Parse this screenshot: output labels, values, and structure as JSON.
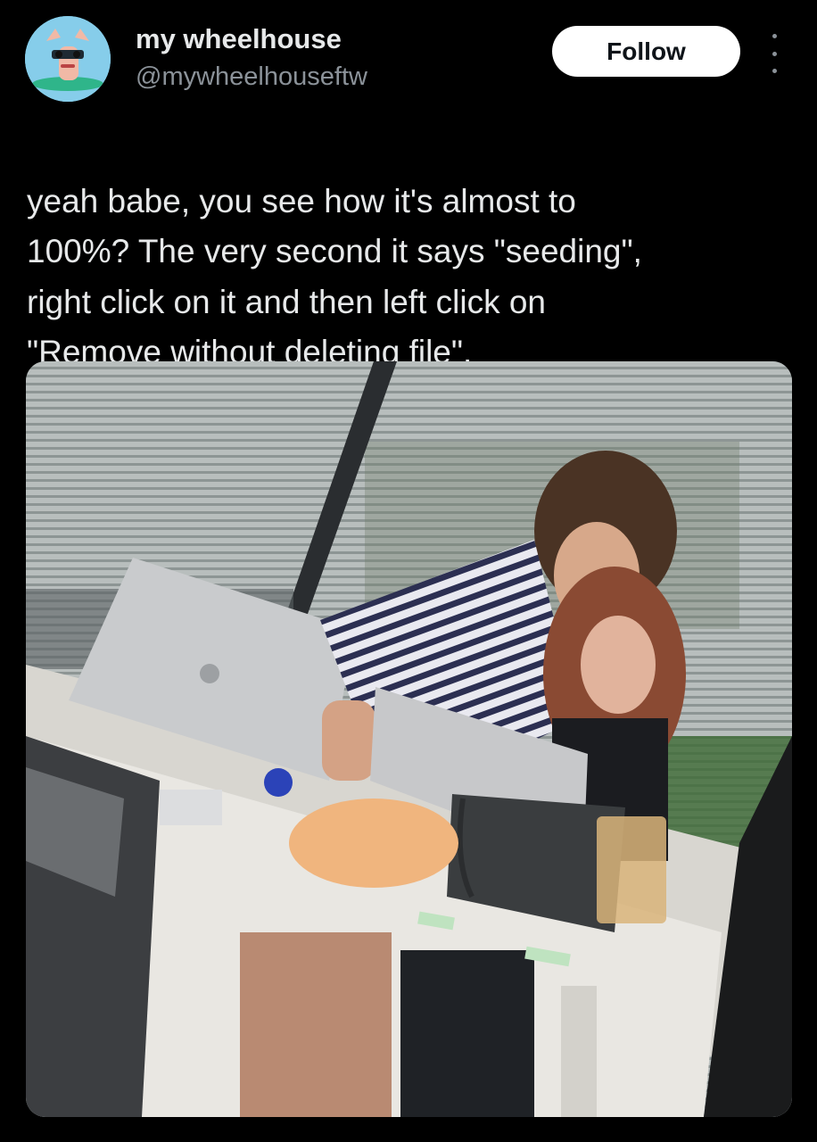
{
  "post": {
    "author": {
      "display_name": "my wheelhouse",
      "handle": "@mywheelhouseftw"
    },
    "follow_label": "Follow",
    "more_icon": "more-vertical-icon",
    "text_lines": [
      "yeah babe, you see how it's almost to",
      "100%? The very second it says \"seeding\",",
      "right click on it and then left click on",
      "\"Remove without deleting file\"."
    ]
  },
  "colors": {
    "background": "#000000",
    "text_primary": "#e7e9ea",
    "text_secondary": "#8b9299",
    "follow_bg": "#ffffff",
    "follow_text": "#0f1419"
  }
}
